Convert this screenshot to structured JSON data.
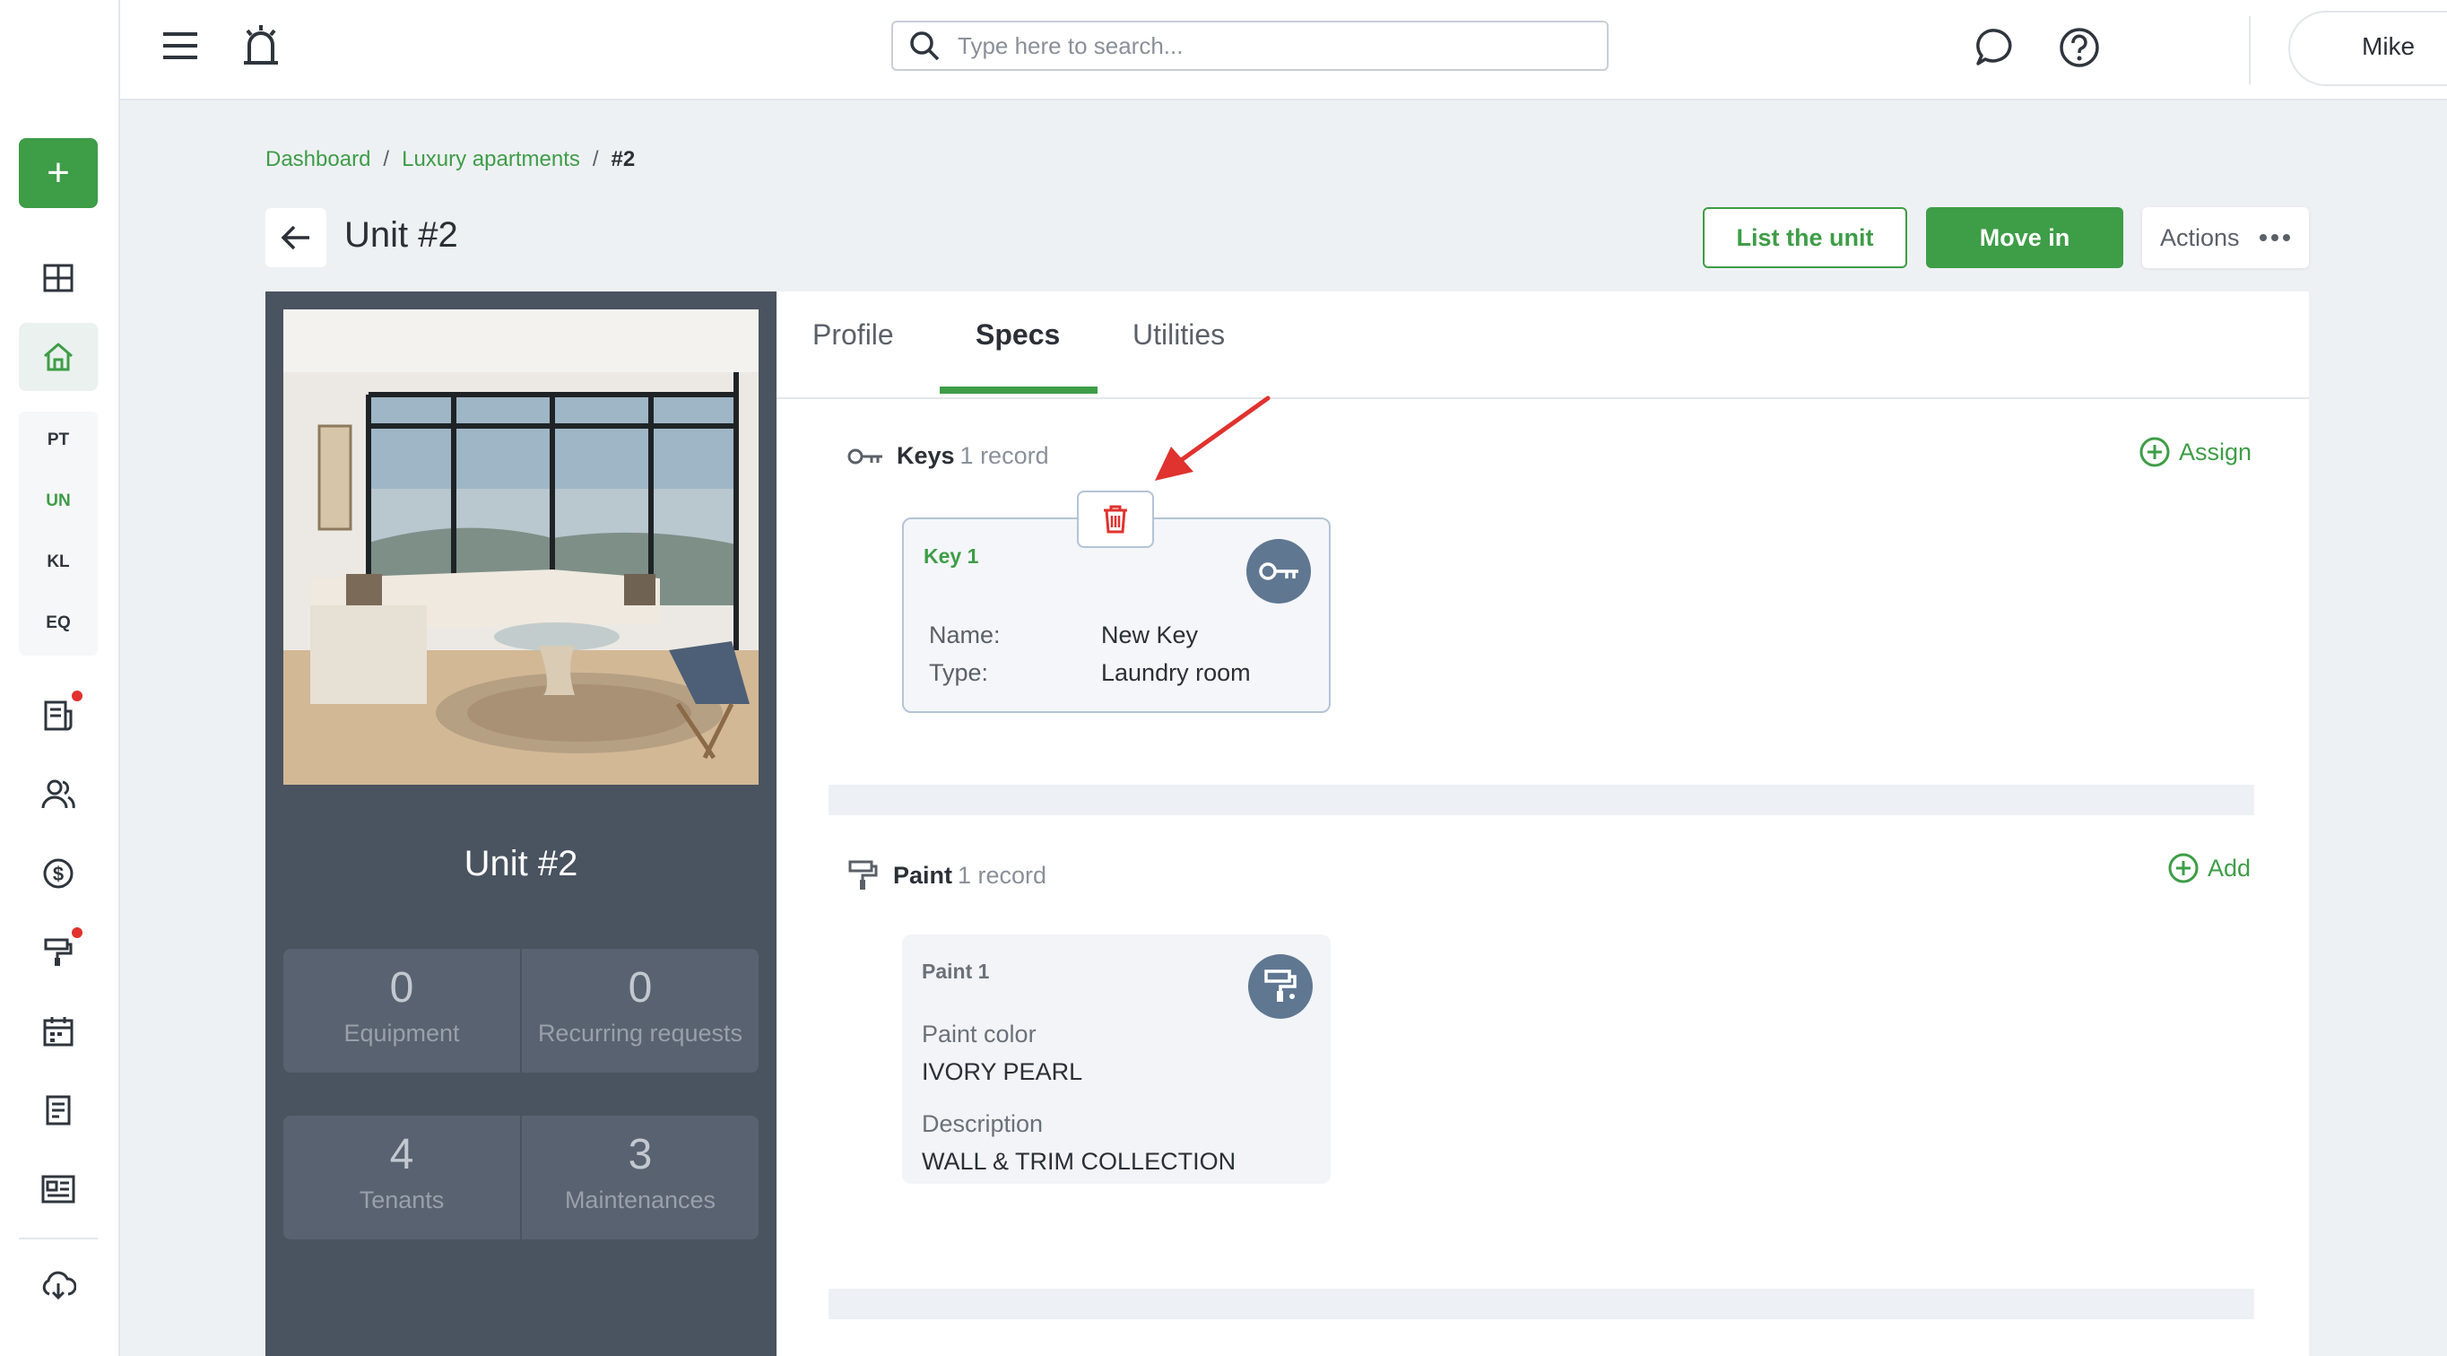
{
  "sidebar": {
    "new_label": "+",
    "sub_items": [
      "PT",
      "UN",
      "KL",
      "EQ"
    ]
  },
  "topbar": {
    "search_placeholder": "Type here to search...",
    "user_name": "Mike"
  },
  "breadcrumb": {
    "items": [
      "Dashboard",
      "Luxury apartments"
    ],
    "separator": "/",
    "current": "#2"
  },
  "page": {
    "title": "Unit #2",
    "list_button": "List the unit",
    "move_in_button": "Move in",
    "actions_button": "Actions"
  },
  "unit_panel": {
    "name": "Unit #2",
    "stats": [
      {
        "value": "0",
        "label": "Equipment"
      },
      {
        "value": "0",
        "label": "Recurring requests"
      },
      {
        "value": "4",
        "label": "Tenants"
      },
      {
        "value": "3",
        "label": "Maintenances"
      }
    ]
  },
  "tabs": [
    "Profile",
    "Specs",
    "Utilities"
  ],
  "active_tab": "Specs",
  "keys": {
    "title": "Keys",
    "count": "1 record",
    "action": "Assign",
    "card": {
      "label": "Key 1",
      "name_label": "Name:",
      "name_value": "New Key",
      "type_label": "Type:",
      "type_value": "Laundry room"
    }
  },
  "paint": {
    "title": "Paint",
    "count": "1 record",
    "action": "Add",
    "card": {
      "label": "Paint 1",
      "color_label": "Paint color",
      "color_value": "IVORY PEARL",
      "desc_label": "Description",
      "desc_value": "WALL & TRIM COLLECTION"
    }
  },
  "colors": {
    "accent": "#3e9d47",
    "panel": "#4a5360",
    "badge": "#5f7791",
    "danger": "#e0322e"
  }
}
